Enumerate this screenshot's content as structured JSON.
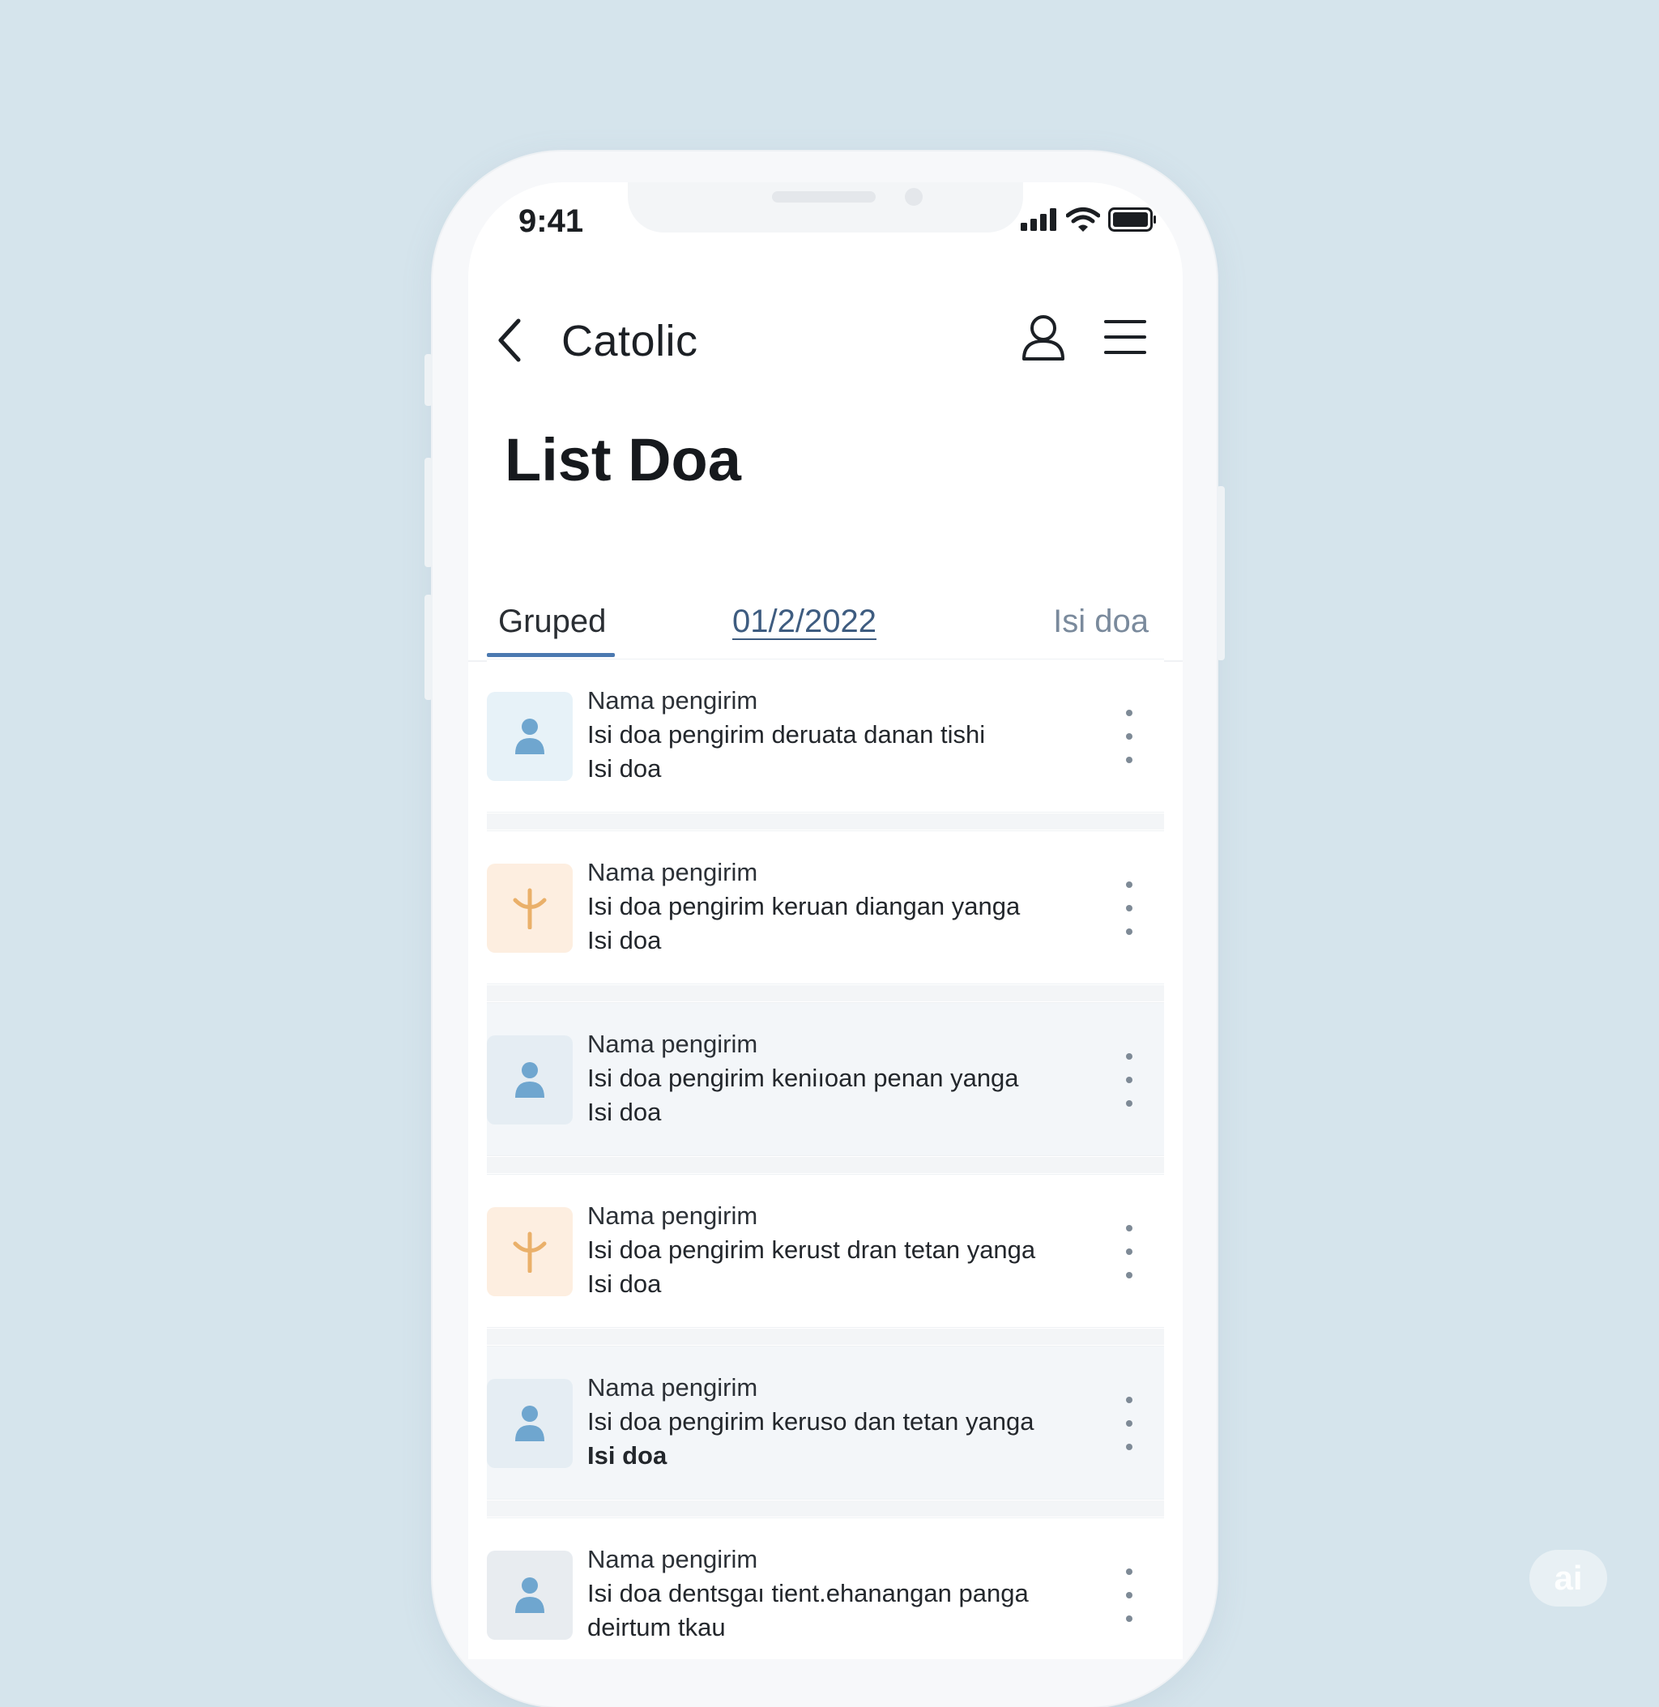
{
  "status_bar": {
    "time": "9:41",
    "icons": [
      "signal-icon",
      "wifi-icon",
      "battery-icon"
    ]
  },
  "header": {
    "back_icon": "chevron-left-icon",
    "title": "Catolic",
    "profile_icon": "user-icon",
    "menu_icon": "hamburger-menu-icon"
  },
  "page": {
    "title": "List Doa"
  },
  "tabs": [
    {
      "label": "Gruped",
      "active": true
    },
    {
      "label": "01/2/2022",
      "active": false
    },
    {
      "label": "Isi doa",
      "active": false
    }
  ],
  "items": [
    {
      "name": "Nama pengirim",
      "body": "Isi doa pengirim deruata danan tishi",
      "sub": "Isi doa",
      "icon": "person-icon"
    },
    {
      "name": "Nama pengirim",
      "body": "Isi doa pengirim keruan diangan yanga",
      "sub": "Isi doa",
      "icon": "cross-icon"
    },
    {
      "name": "Nama pengirim",
      "body": "Isi doa pengirim keniıoan penan yanga",
      "sub": "Isi doa",
      "icon": "person-icon"
    },
    {
      "name": "Nama pengirim",
      "body": "Isi doa pengirim kerust dran tetan yanga",
      "sub": "Isi doa",
      "icon": "cross-icon"
    },
    {
      "name": "Nama pengirim",
      "body": "Isi doa pengirim keruso dan tetan yanga",
      "sub": "Isi doa",
      "icon": "person-icon"
    },
    {
      "name": "Nama pengirim",
      "body": "Isi doa dentsgaı tient.ehanangan panga",
      "sub": "deirtum tkau",
      "icon": "person-icon"
    }
  ],
  "watermark": "ai",
  "colors": {
    "background": "#d5e4ec",
    "accent": "#4b79b0",
    "person_icon": "#6fa6cf",
    "cross_icon": "#eab06a"
  }
}
